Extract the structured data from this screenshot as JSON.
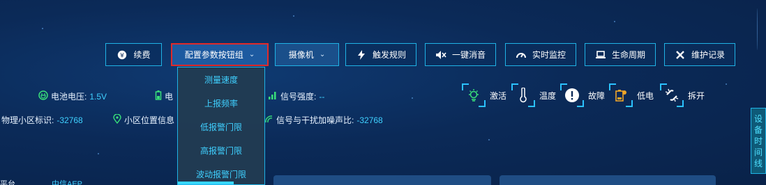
{
  "toolbar": {
    "renew": "续费",
    "config": "配置参数按钮组",
    "camera": "摄像机",
    "trigger": "触发规则",
    "mute": "一键消音",
    "monitor": "实时监控",
    "lifecycle": "生命周期",
    "maintenance": "维护记录"
  },
  "status": {
    "battery_voltage_label": "电池电压:",
    "battery_voltage_value": "1.5V",
    "battery_partial_label": "电",
    "signal_strength_label": "信号强度:",
    "signal_strength_value": "--",
    "cell_id_label": "物理小区标识:",
    "cell_id_value": "-32768",
    "cell_location_label": "小区位置信息",
    "sinr_label": "信号与干扰加噪声比:",
    "sinr_value": "-32768"
  },
  "indicators": {
    "activate": "激活",
    "temperature": "温度",
    "fault": "故障",
    "low_battery": "低电",
    "tamper": "拆开"
  },
  "dropdown": {
    "items": [
      "测量速度",
      "上报频率",
      "低报警门限",
      "高报警门限",
      "波动报警门限"
    ]
  },
  "sidetab": {
    "chars": [
      "设",
      "备",
      "时",
      "间",
      "线"
    ]
  },
  "bottom": {
    "partial_left": "平台",
    "partial_value": "中信AEP"
  },
  "colors": {
    "accent": "#1fb3e6",
    "value": "#3fd0ff",
    "highlight_border": "#e02a2a"
  }
}
